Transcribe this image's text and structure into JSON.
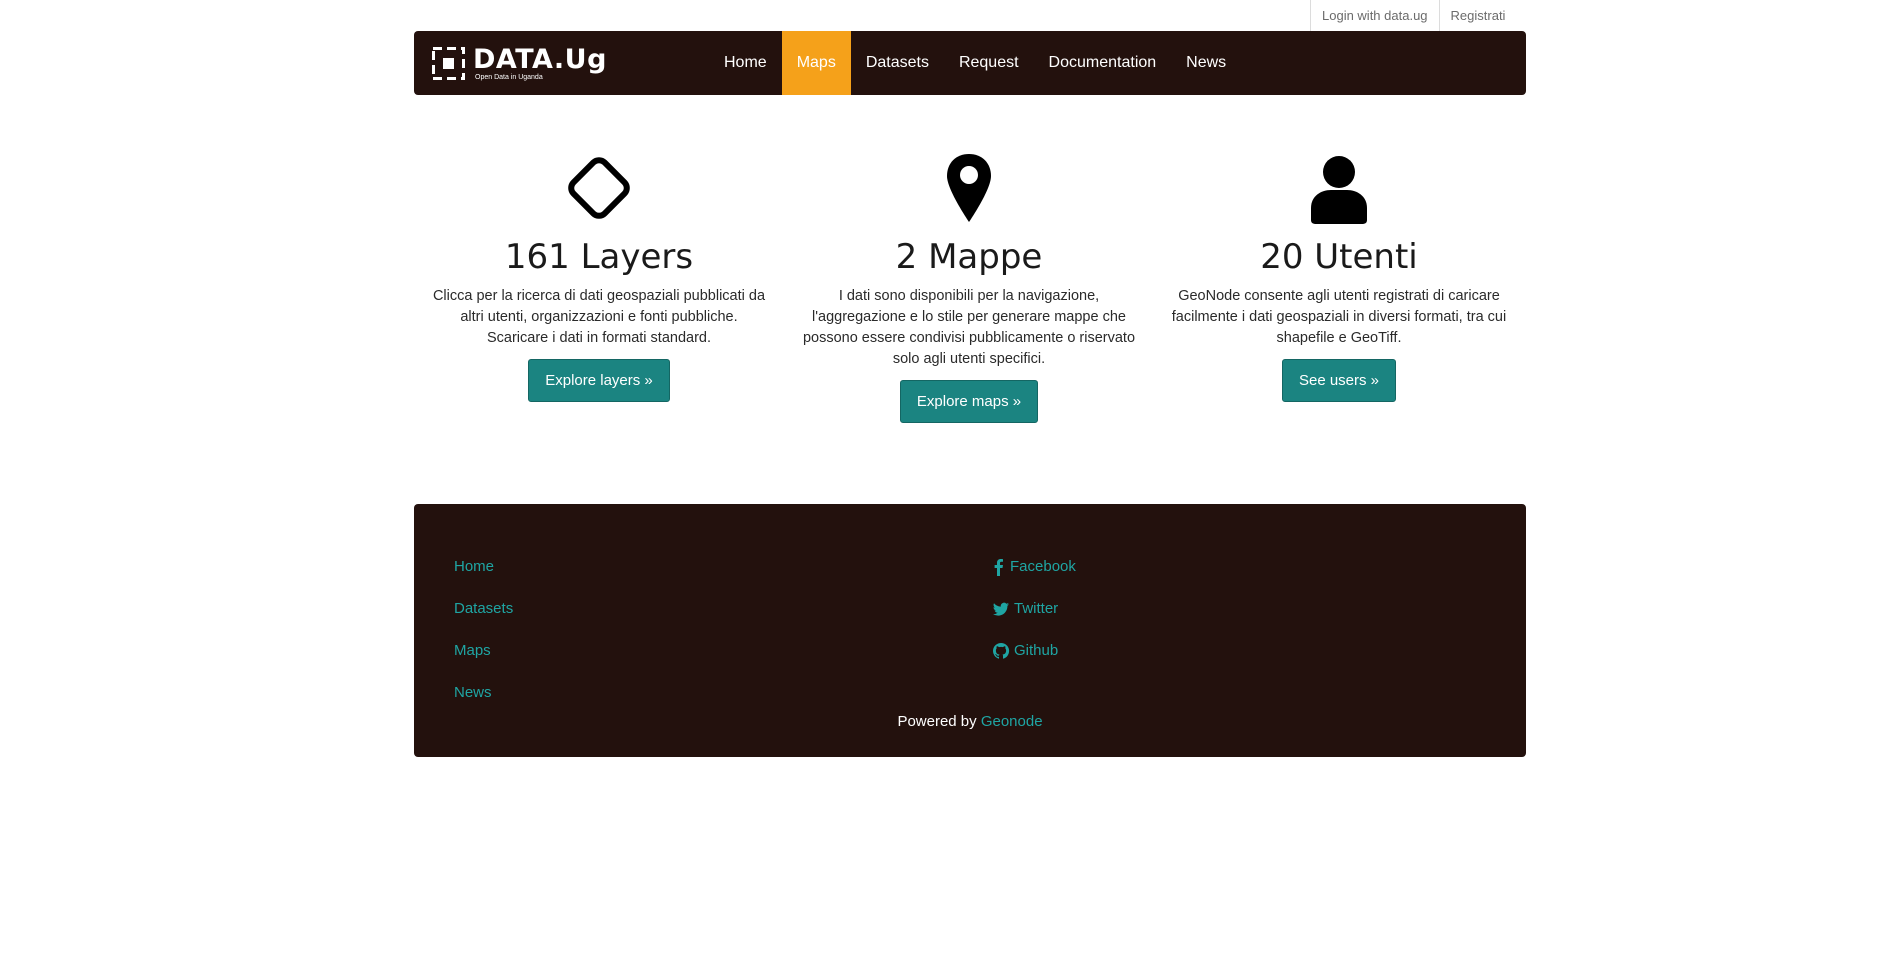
{
  "auth": {
    "login": "Login with data.ug",
    "register": "Registrati"
  },
  "brand": {
    "name": "DATA.Ug",
    "tagline": "Open Data in Uganda"
  },
  "nav": [
    {
      "label": "Home",
      "active": false
    },
    {
      "label": "Maps",
      "active": true
    },
    {
      "label": "Datasets",
      "active": false
    },
    {
      "label": "Request",
      "active": false
    },
    {
      "label": "Documentation",
      "active": false
    },
    {
      "label": "News",
      "active": false
    }
  ],
  "features": [
    {
      "icon": "diamond-icon",
      "title": "161 Layers",
      "text": "Clicca per la ricerca di dati geospaziali pubblicati da altri utenti, organizzazioni e fonti pubbliche. Scaricare i dati in formati standard.",
      "button": "Explore layers »"
    },
    {
      "icon": "map-marker-icon",
      "title": "2 Mappe",
      "text": "I dati sono disponibili per la navigazione, l'aggregazione e lo stile per generare mappe che possono essere condivisi pubblicamente o riservato solo agli utenti specifici.",
      "button": "Explore maps »"
    },
    {
      "icon": "user-icon",
      "title": "20 Utenti",
      "text": "GeoNode consente agli utenti registrati di caricare facilmente i dati geospaziali in diversi formati, tra cui shapefile e GeoTiff.",
      "button": "See users »"
    }
  ],
  "footer": {
    "links": [
      "Home",
      "Datasets",
      "Maps",
      "News"
    ],
    "social": [
      {
        "icon": "facebook-icon",
        "label": "Facebook"
      },
      {
        "icon": "twitter-icon",
        "label": "Twitter"
      },
      {
        "icon": "github-icon",
        "label": "Github"
      }
    ],
    "powered_prefix": "Powered by",
    "powered_link": "Geonode"
  },
  "colors": {
    "nav_bg": "#23110d",
    "active": "#f5a11a",
    "button": "#1b8481",
    "link": "#1fa5a3"
  }
}
